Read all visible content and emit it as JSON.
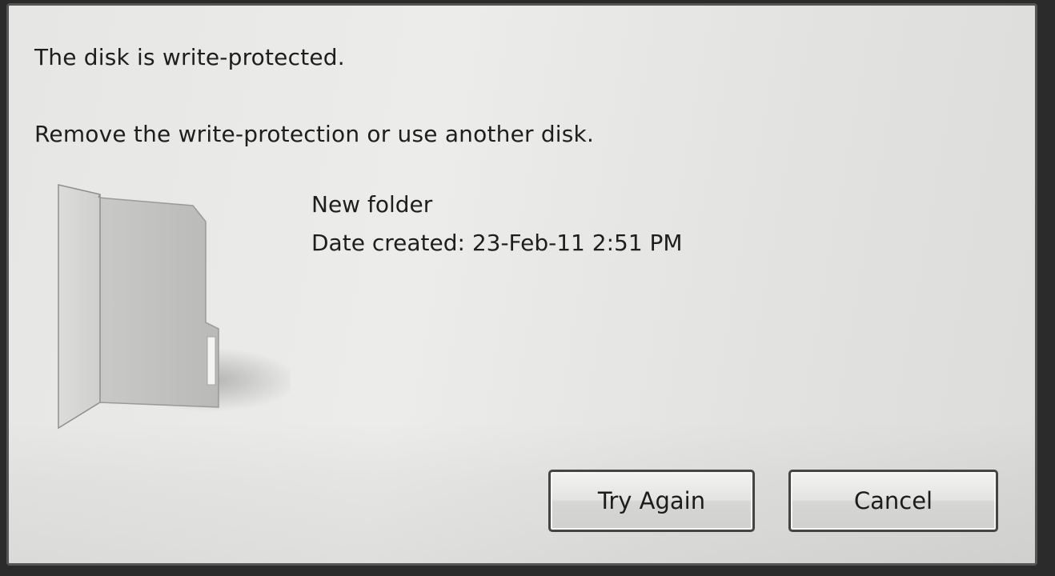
{
  "dialog": {
    "heading": "The disk is write-protected.",
    "instruction": "Remove the write-protection or use another disk.",
    "item": {
      "icon": "folder-icon",
      "name": "New folder",
      "date_created": "Date created: 23-Feb-11 2:51 PM"
    },
    "buttons": {
      "try_again": "Try Again",
      "cancel": "Cancel"
    }
  }
}
